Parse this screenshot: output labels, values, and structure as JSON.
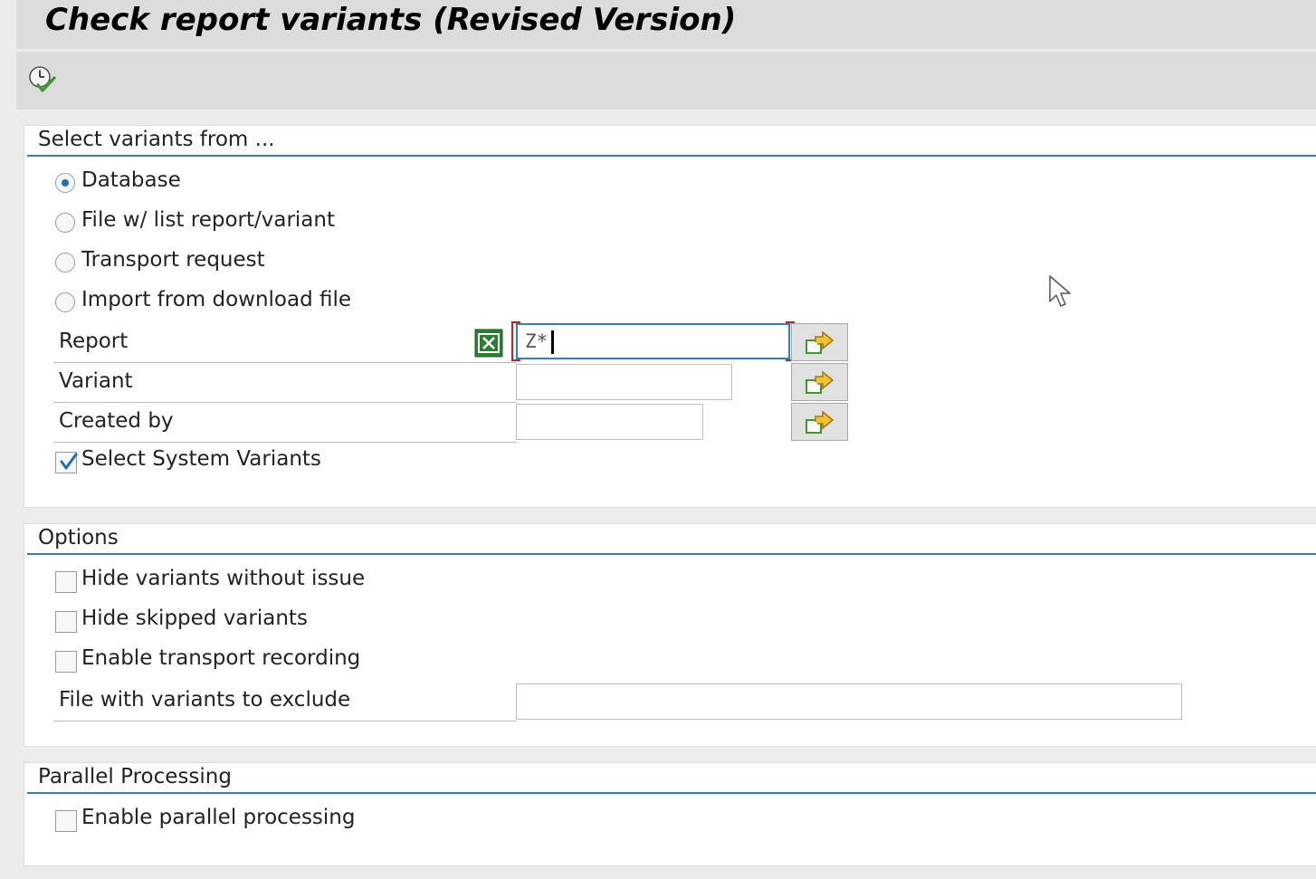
{
  "window": {
    "title": "Check report variants (Revised Version)"
  },
  "toolbar": {
    "execute_icon": "clock-check-icon"
  },
  "groups": {
    "select": {
      "title": "Select variants from ...",
      "options": [
        {
          "label": "Database",
          "selected": true
        },
        {
          "label": "File w/ list report/variant",
          "selected": false
        },
        {
          "label": "Transport request",
          "selected": false
        },
        {
          "label": "Import from download file",
          "selected": false
        }
      ],
      "fields": {
        "report": {
          "label": "Report",
          "value": "Z*"
        },
        "variant": {
          "label": "Variant",
          "value": ""
        },
        "created_by": {
          "label": "Created by",
          "value": ""
        }
      },
      "system_variants": {
        "label": "Select System Variants",
        "checked": true
      }
    },
    "options": {
      "title": "Options",
      "checks": [
        {
          "label": "Hide variants without issue",
          "checked": false
        },
        {
          "label": "Hide skipped variants",
          "checked": false
        },
        {
          "label": "Enable transport recording",
          "checked": false
        }
      ],
      "exclude_file": {
        "label": "File with variants to exclude",
        "value": ""
      }
    },
    "parallel": {
      "title": "Parallel Processing",
      "checks": [
        {
          "label": "Enable parallel processing",
          "checked": false
        }
      ]
    }
  },
  "colors": {
    "accent": "#2f7fb8",
    "focus_bracket": "#b8272b",
    "panel_bg": "#ffffff",
    "chrome_bg": "#dcdcdc"
  }
}
